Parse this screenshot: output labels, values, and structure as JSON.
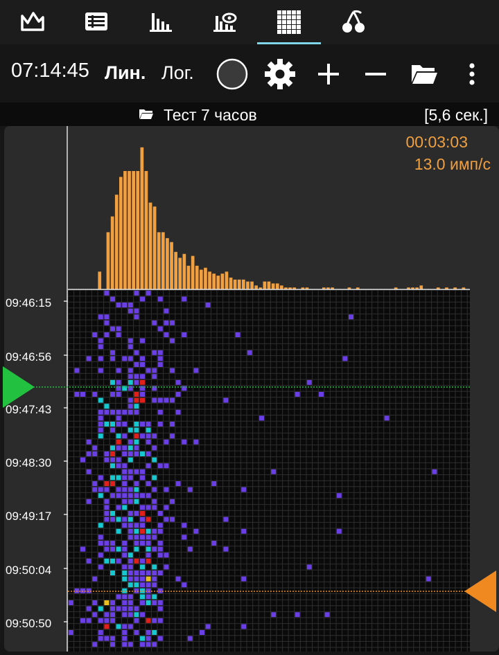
{
  "tabs": [
    {
      "name": "tab-dose-rate",
      "icon": "area-chart-icon",
      "active": false
    },
    {
      "name": "tab-table",
      "icon": "table-icon",
      "active": false
    },
    {
      "name": "tab-spectrum",
      "icon": "bar-chart-icon",
      "active": false
    },
    {
      "name": "tab-spectrum-view",
      "icon": "chart-eye-icon",
      "active": false
    },
    {
      "name": "tab-spectrogram",
      "icon": "grid-icon",
      "active": true
    },
    {
      "name": "tab-isotopes",
      "icon": "cherry-icon",
      "active": false
    }
  ],
  "toolbar": {
    "clock": "07:14:45",
    "scale_linear": "Лин.",
    "scale_log": "Лог."
  },
  "file": {
    "name": "Тест 7 часов",
    "time_range": "[5,6 сек.]"
  },
  "overlay": {
    "duration": "00:03:03",
    "rate": "13.0 имп/с"
  },
  "time_labels": [
    "09:46:15",
    "09:46:56",
    "09:47:43",
    "09:48:30",
    "09:49:17",
    "09:50:04",
    "09:50:50"
  ],
  "colors": {
    "accent": "#f0a040",
    "tab_indicator": "#7fd6e8",
    "cell_low": "#6a3fe6",
    "cell_mid": "#18c8d0",
    "cell_high": "#e0201a",
    "cell_peak": "#e8c020",
    "green_marker": "#22c240",
    "orange_marker": "#f08a20"
  },
  "chart_data": {
    "type": "bar",
    "title": "",
    "xlabel": "",
    "ylabel": "",
    "values": [
      0,
      0,
      0,
      0,
      0,
      0,
      0,
      9,
      0,
      29,
      37,
      48,
      57,
      60,
      60,
      60,
      60,
      72,
      60,
      44,
      42,
      29,
      29,
      26,
      24,
      19,
      16,
      18,
      12,
      17,
      12,
      10,
      11,
      9,
      8,
      7,
      8,
      9,
      6,
      5,
      5,
      5,
      4,
      4,
      2,
      1,
      4,
      4,
      3,
      3,
      2,
      1,
      1,
      1,
      0,
      1,
      1,
      0,
      0,
      0,
      1,
      1,
      1,
      0,
      0,
      0,
      1,
      0,
      1,
      0,
      0,
      0,
      0,
      0,
      0,
      0,
      0,
      1,
      0,
      0,
      1,
      1,
      1,
      2,
      0,
      0,
      0,
      1,
      0,
      1,
      0,
      1,
      0,
      1,
      0
    ],
    "ylim": [
      0,
      80
    ]
  }
}
